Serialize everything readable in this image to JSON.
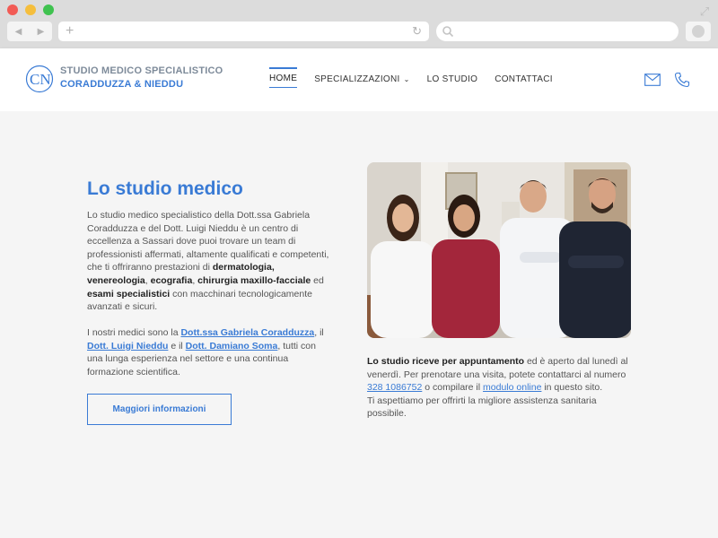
{
  "site": {
    "brand_line1": "STUDIO MEDICO SPECIALISTICO",
    "brand_line2": "CORADDUZZA & NIEDDU",
    "logo_letters": "CN",
    "accent_color": "#3a7bd5"
  },
  "nav": {
    "items": [
      {
        "label": "HOME"
      },
      {
        "label": "SPECIALIZZAZIONI"
      },
      {
        "label": "LO STUDIO"
      },
      {
        "label": "CONTATTACI"
      }
    ]
  },
  "main": {
    "title": "Lo studio medico",
    "p1": {
      "t1": "Lo studio medico specialistico della Dott.ssa Gabriela Coradduzza e del Dott. Luigi Nieddu è un centro di eccellenza a Sassari dove puoi trovare un team di professionisti affermati, altamente qualificati e competenti, che ti offriranno prestazioni di ",
      "b1": "dermatologia, venereologia",
      "t2": ", ",
      "b2": "ecografia",
      "t3": ", ",
      "b3": "chirurgia maxillo-facciale",
      "t4": " ed ",
      "b4": "esami specialistici",
      "t5": " con macchinari tecnologicamente avanzati e sicuri."
    },
    "p2": {
      "t1": "I nostri medici sono la ",
      "l1": "Dott.ssa Gabriela Coradduzza",
      "t2": ", il ",
      "l2": "Dott. Luigi Nieddu",
      "t3": " e il ",
      "l3": "Dott. Damiano Soma",
      "t4": ", tutti con una lunga esperienza nel settore e una continua formazione scientifica."
    },
    "button_label": "Maggiori informazioni"
  },
  "info": {
    "b1": "Lo studio riceve per appuntamento",
    "t1": " ed è aperto dal lunedì al venerdì. Per prenotare una visita, potete contattarci al numero ",
    "phone": "328 1086752",
    "t2": " o compilare il ",
    "form_link": "modulo online",
    "t3": " in questo sito.",
    "t4": "Ti aspettiamo per offrirti la migliore assistenza sanitaria possibile."
  }
}
